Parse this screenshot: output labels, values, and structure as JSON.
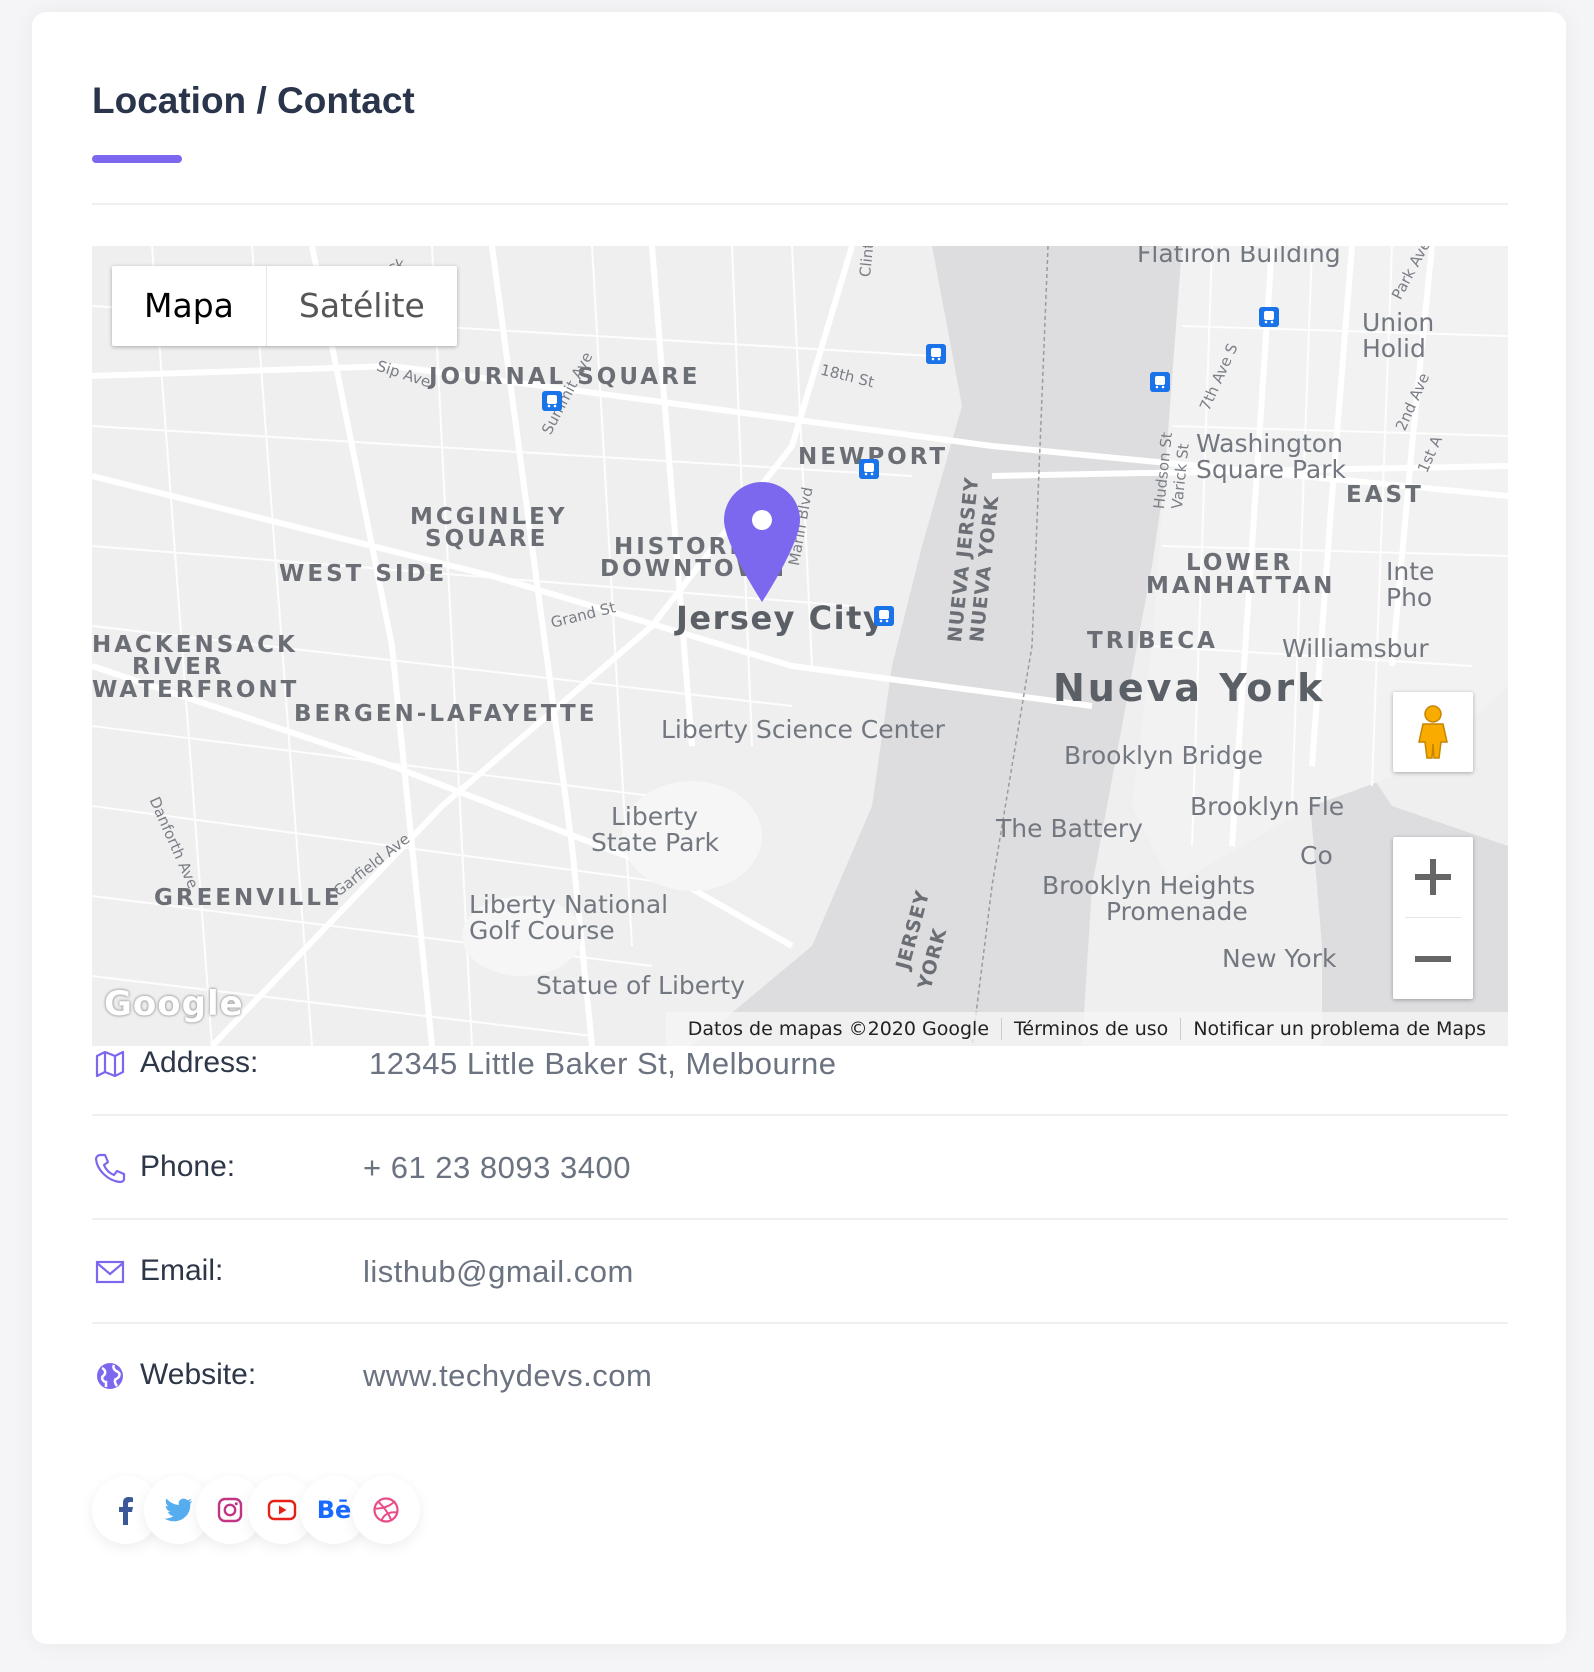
{
  "section": {
    "title": "Location / Contact",
    "accent_color": "#7b68ee"
  },
  "map": {
    "type_controls": [
      "Mapa",
      "Satélite"
    ],
    "active_type": "Mapa",
    "labels": {
      "journal_square": "JOURNAL SQUARE",
      "newport": "NEWPORT",
      "mcginley_1": "MCGINLEY",
      "mcginley_2": "SQUARE",
      "west_side": "WEST SIDE",
      "historic_1": "HISTORIC",
      "historic_2": "DOWNTOWN",
      "jersey_city": "Jersey City",
      "hackensack_1": "HACKENSACK",
      "hackensack_2": "RIVER",
      "hackensack_3": "WATERFRONT",
      "bergen": "BERGEN-LAFAYETTE",
      "liberty_science": "Liberty Science Center",
      "liberty_park_1": "Liberty",
      "liberty_park_2": "State Park",
      "golf_1": "Liberty National",
      "golf_2": "Golf Course",
      "greenville": "GREENVILLE",
      "statue": "Statue of Liberty",
      "flatiron": "Flatiron Building",
      "union_1": "Union",
      "union_2": "Holid",
      "washington_1": "Washington",
      "washington_2": "Square Park",
      "east": "EAST",
      "lower_1": "LOWER",
      "lower_2": "MANHATTAN",
      "inte_1": "Inte",
      "inte_2": "Pho",
      "tribeca": "TRIBECA",
      "williamsburg": "Williamsbur",
      "nueva_york": "Nueva York",
      "manh": "Manh",
      "brooklyn_bridge": "Brooklyn Bridge",
      "brooklyn_flea": "Brooklyn Fle",
      "battery": "The Battery",
      "heights_1": "Brooklyn Heights",
      "heights_2": "Promenade",
      "new_york": "New York",
      "co": "Co",
      "nueva_jersey": "NUEVA JERSEY",
      "nueva_york_border": "NUEVA YORK",
      "jersey_bottom": "JERSEY",
      "york_bottom": "YORK",
      "streets": {
        "sip_ave": "Sip Ave",
        "summit_ave": "Summit Ave",
        "grand_st": "Grand St",
        "marin_blvd": "Marin Blvd",
        "18th_st": "18th St",
        "clinton": "Clinto",
        "danforth_ave": "Danforth Ave",
        "garfield_ave": "Garfield Ave",
        "hudson_st": "Hudson St",
        "varick_st": "Varick St",
        "7th_ave_s": "7th Ave S",
        "park_ave": "Park Ave",
        "2nd_ave": "2nd Ave",
        "1st_ave": "1st A",
        "hack": "Hack"
      }
    },
    "google_logo": "Google",
    "attribution": [
      "Datos de mapas ©2020 Google",
      "Términos de uso",
      "Notificar un problema de Maps"
    ],
    "pin_color": "#7b68ee"
  },
  "contact": {
    "address_label": "Address:",
    "address_value": "12345 Little Baker St, Melbourne",
    "phone_label": "Phone:",
    "phone_value": "+ 61 23 8093 3400",
    "email_label": "Email:",
    "email_value": "listhub@gmail.com",
    "website_label": "Website:",
    "website_value": "www.techydevs.com"
  },
  "socials": [
    {
      "name": "facebook-icon",
      "color": "#3b5998"
    },
    {
      "name": "twitter-icon",
      "color": "#55acee"
    },
    {
      "name": "instagram-icon",
      "color": "#c13584"
    },
    {
      "name": "youtube-icon",
      "color": "#e62117"
    },
    {
      "name": "behance-icon",
      "color": "#1769ff",
      "text": "Bē"
    },
    {
      "name": "dribbble-icon",
      "color": "#ea4c89"
    }
  ]
}
